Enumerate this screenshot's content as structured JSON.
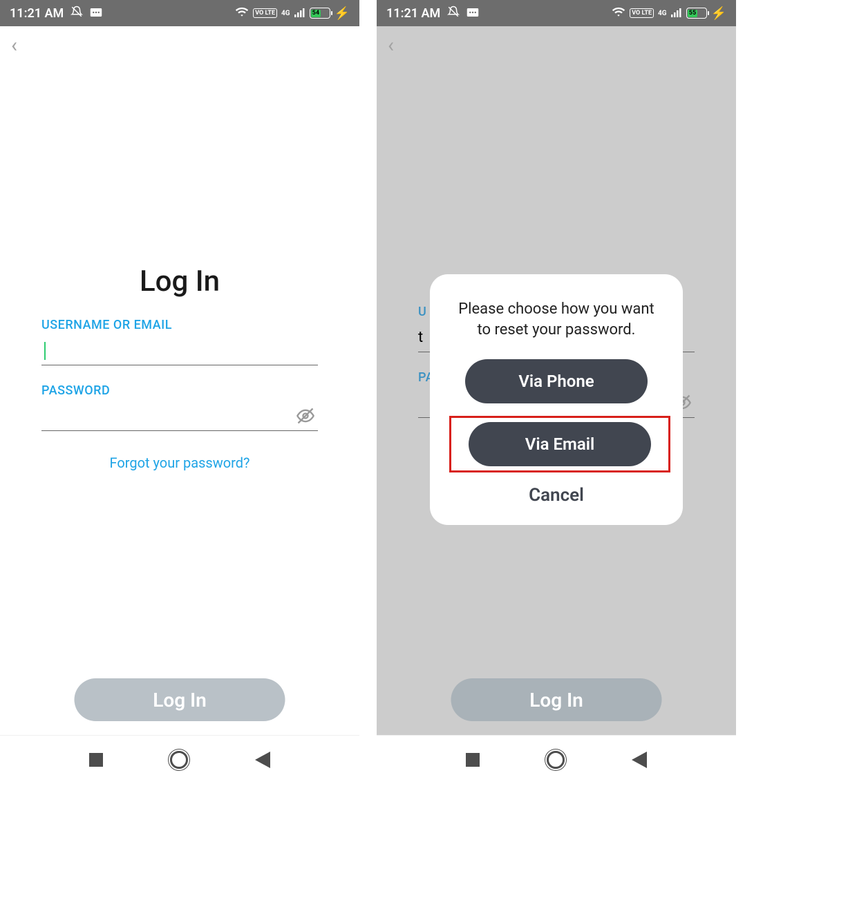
{
  "status": {
    "time": "11:21 AM",
    "battery_left": "54",
    "battery_right": "55",
    "network_label": "4G",
    "volte": "VO LTE"
  },
  "login": {
    "title": "Log In",
    "username_label": "USERNAME OR EMAIL",
    "password_label": "PASSWORD",
    "forgot": "Forgot your password?",
    "button": "Log In",
    "username_value_right": "t",
    "username_label_short": "U",
    "password_label_short": "PA"
  },
  "modal": {
    "title": "Please choose how you want to reset your password.",
    "via_phone": "Via Phone",
    "via_email": "Via Email",
    "cancel": "Cancel"
  }
}
